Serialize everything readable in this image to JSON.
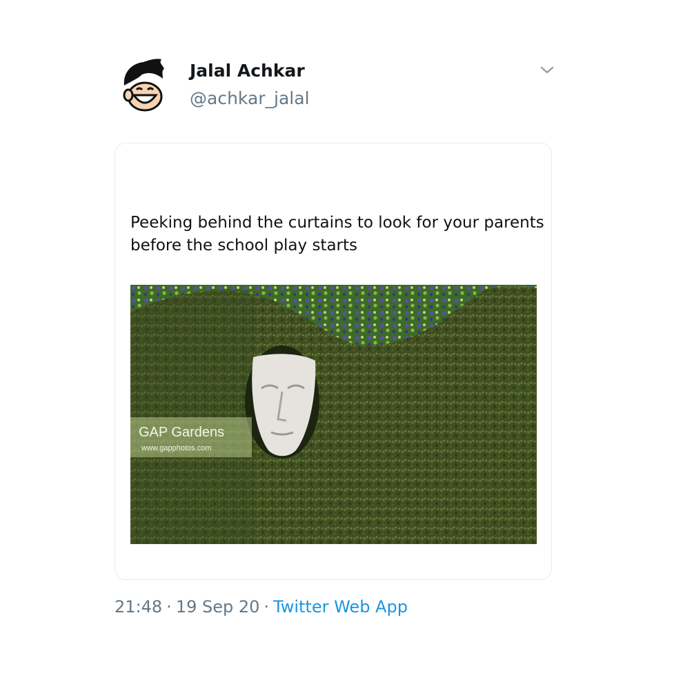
{
  "tweet": {
    "author": {
      "name": "Jalal Achkar",
      "handle": "@achkar_jalal",
      "avatar_icon": "cartoon-face-avatar"
    },
    "menu_icon": "chevron-down-icon",
    "caption_lines": [
      "Peeking behind the curtains to look for your parents",
      "before the school play starts"
    ],
    "image": {
      "watermark_title": "GAP Gardens",
      "watermark_url": "www.gapphotos.com"
    },
    "time": "21:48",
    "date": "19 Sep 20",
    "separator": "·",
    "source": "Twitter Web App"
  },
  "colors": {
    "name": "#14171a",
    "secondary": "#657786",
    "link": "#1b95e0",
    "card_border": "#e6ecf0"
  }
}
